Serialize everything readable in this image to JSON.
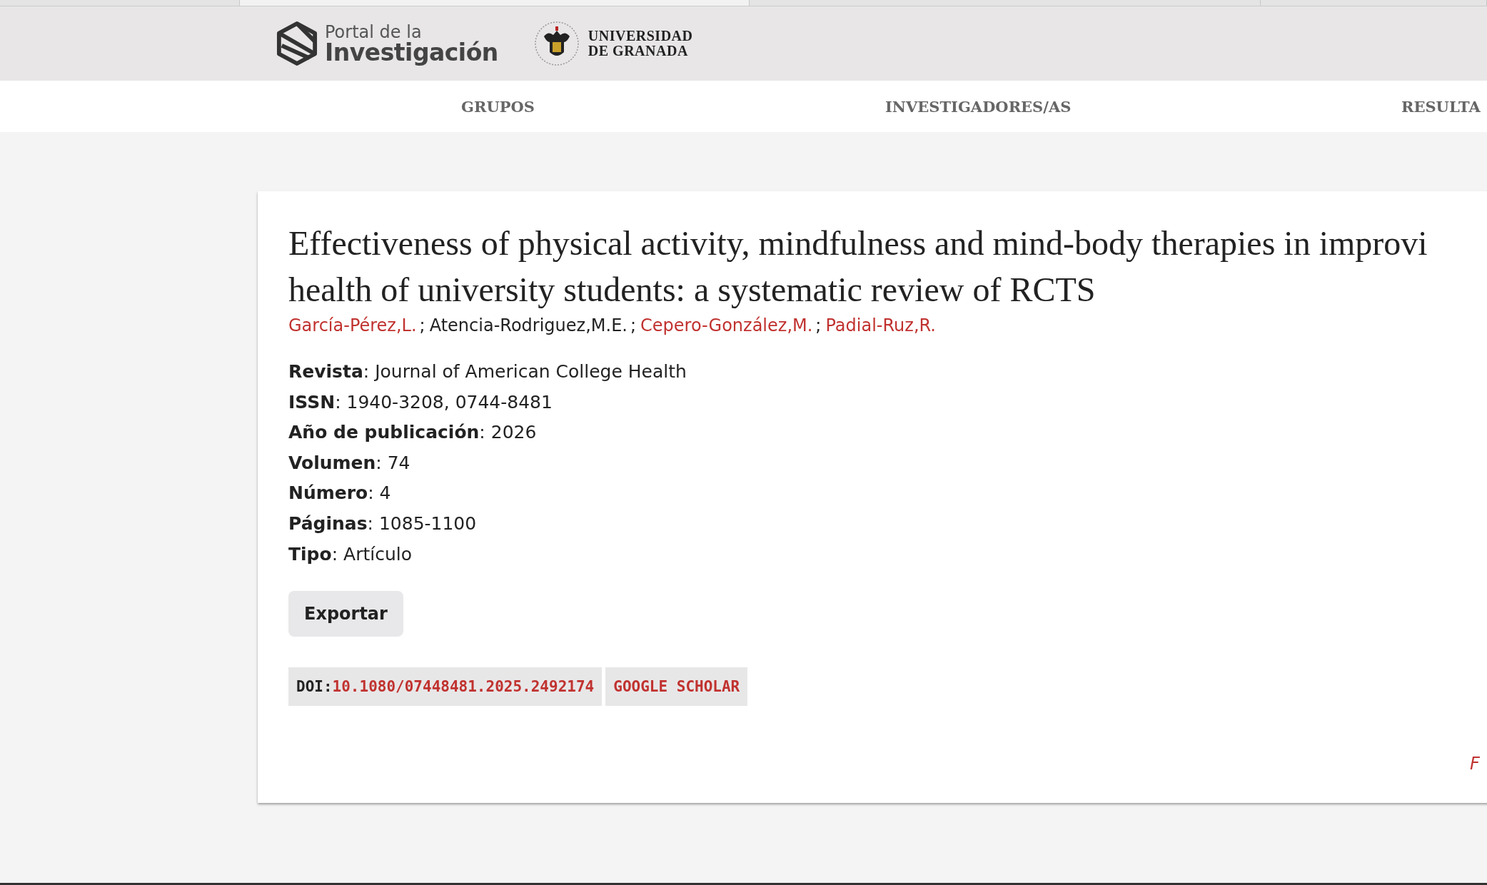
{
  "header": {
    "portal_logo": {
      "line_1": "Portal de la",
      "line_2": "Investigación"
    },
    "university_logo": {
      "line_1": "UNIVERSIDAD",
      "line_2": "DE GRANADA"
    }
  },
  "nav": [
    {
      "label": "GRUPOS"
    },
    {
      "label": "INVESTIGADORES/AS"
    },
    {
      "label": "RESULTA"
    }
  ],
  "publication": {
    "title": "Effectiveness of physical activity, mindfulness and mind-body therapies in improvi",
    "title_line_2": "health of university students: a systematic review of RCTS",
    "authors": [
      {
        "name": "García-Pérez,L.",
        "linked": true,
        "separator": ";"
      },
      {
        "name": "Atencia-Rodriguez,M.E.",
        "linked": false,
        "separator": ";"
      },
      {
        "name": "Cepero-González,M.",
        "linked": true,
        "separator": ";"
      },
      {
        "name": "Padial-Ruz,R.",
        "linked": true
      }
    ],
    "fields": [
      "**Revista**: Journal of American College Health",
      "**ISSN**: 1940-3208, 0744-8481",
      "**Año de publicación**: 2026",
      "**Volumen**: 74",
      "**Número**: 4",
      "**Páginas**: 1085-1100",
      "**Tipo**: Artículo"
    ],
    "export_button": "Exportar",
    "doi_label": "DOI:",
    "doi": "10.1080/07448481.2025.2492174",
    "scholar_link": "GOOGLE SCHOLAR",
    "corner_link": "F"
  }
}
